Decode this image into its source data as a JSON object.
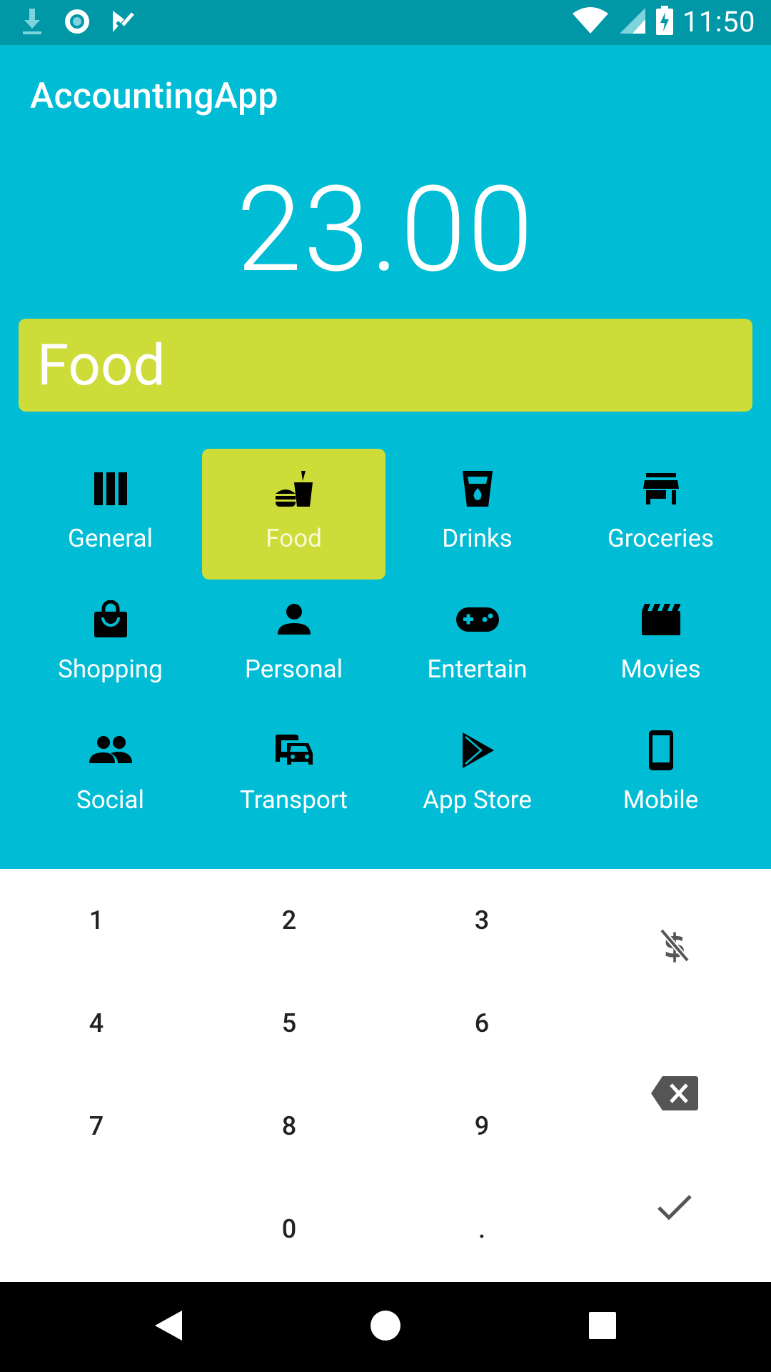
{
  "status_bar": {
    "time": "11:50",
    "icons_left": [
      "download-icon",
      "record-icon",
      "tasks-icon"
    ],
    "icons_right": [
      "wifi-icon",
      "cell-signal-icon",
      "battery-charging-icon"
    ]
  },
  "app": {
    "title": "AccountingApp"
  },
  "amount": "23.00",
  "selected_category": "Food",
  "colors": {
    "primary": "#00BCD4",
    "primary_dark": "#0097A7",
    "accent": "#CDDC39"
  },
  "categories": [
    {
      "label": "General",
      "icon": "columns-icon",
      "selected": false
    },
    {
      "label": "Food",
      "icon": "fastfood-icon",
      "selected": true
    },
    {
      "label": "Drinks",
      "icon": "drink-cup-icon",
      "selected": false
    },
    {
      "label": "Groceries",
      "icon": "store-icon",
      "selected": false
    },
    {
      "label": "Shopping",
      "icon": "shopping-bag-icon",
      "selected": false
    },
    {
      "label": "Personal",
      "icon": "person-icon",
      "selected": false
    },
    {
      "label": "Entertain",
      "icon": "gamepad-icon",
      "selected": false
    },
    {
      "label": "Movies",
      "icon": "clapperboard-icon",
      "selected": false
    },
    {
      "label": "Social",
      "icon": "people-icon",
      "selected": false
    },
    {
      "label": "Transport",
      "icon": "transport-icon",
      "selected": false
    },
    {
      "label": "App Store",
      "icon": "play-store-icon",
      "selected": false
    },
    {
      "label": "Mobile",
      "icon": "smartphone-icon",
      "selected": false
    }
  ],
  "keypad": {
    "keys": [
      "1",
      "2",
      "3",
      "4",
      "5",
      "6",
      "7",
      "8",
      "9",
      "0",
      "."
    ],
    "actions": [
      "no-money-icon",
      "backspace-icon",
      "check-icon"
    ]
  },
  "nav": [
    "back-icon",
    "home-icon",
    "recents-icon"
  ]
}
